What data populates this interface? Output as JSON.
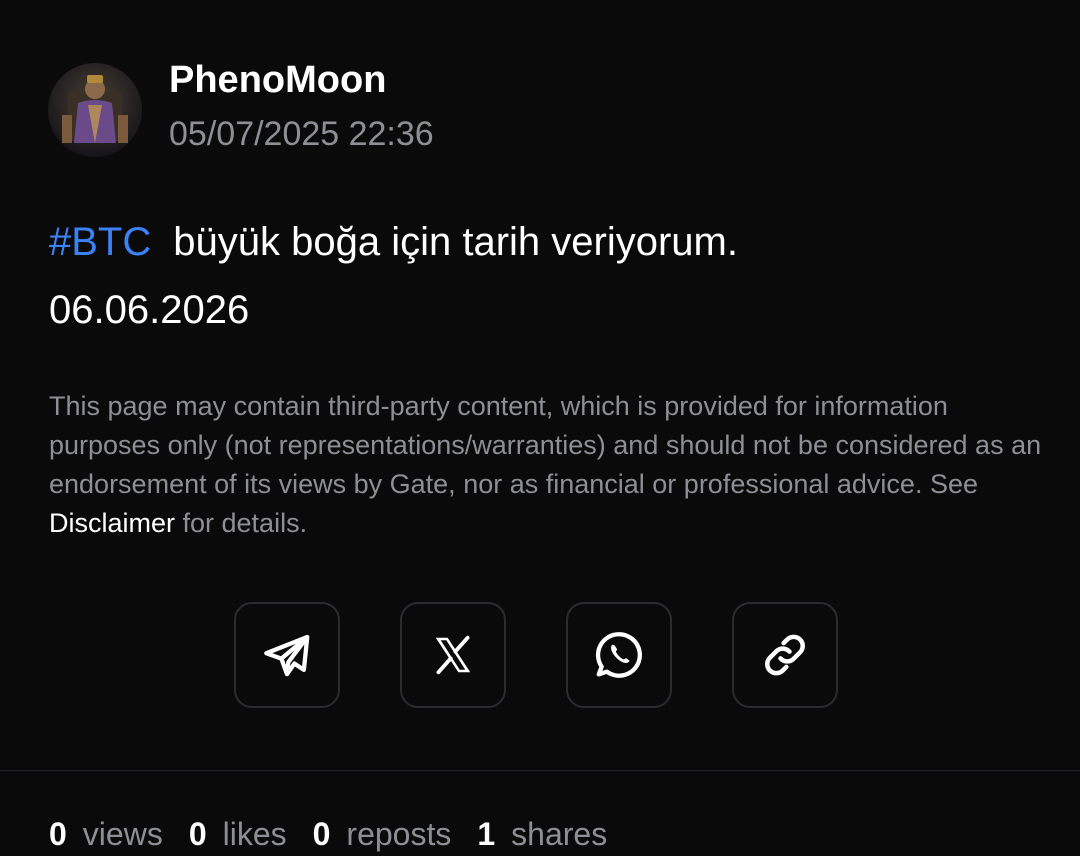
{
  "author": {
    "name": "PhenoMoon",
    "avatar_alt": "PhenoMoon",
    "timestamp": "05/07/2025 22:36"
  },
  "post": {
    "hashtag": "#BTC",
    "text": "büyük boğa için tarih veriyorum.",
    "line2": "06.06.2026"
  },
  "disclaimer": {
    "text_before": "This page may contain third-party content, which is provided for information purposes only (not representations/warranties) and should not be considered as an endorsement of its views by Gate, nor as financial or professional advice. See ",
    "link_label": "Disclaimer",
    "text_after": " for details."
  },
  "share": {
    "buttons": [
      {
        "icon": "telegram-icon"
      },
      {
        "icon": "x-icon"
      },
      {
        "icon": "whatsapp-icon"
      },
      {
        "icon": "link-icon"
      }
    ]
  },
  "stats": {
    "views_count": "0",
    "views_label": "views",
    "likes_count": "0",
    "likes_label": "likes",
    "reposts_count": "0",
    "reposts_label": "reposts",
    "shares_count": "1",
    "shares_label": "shares"
  },
  "colors": {
    "background": "#0a0a0b",
    "hashtag": "#3b82f6",
    "muted_text": "#8d8f94",
    "button_border": "#2a2c30"
  }
}
